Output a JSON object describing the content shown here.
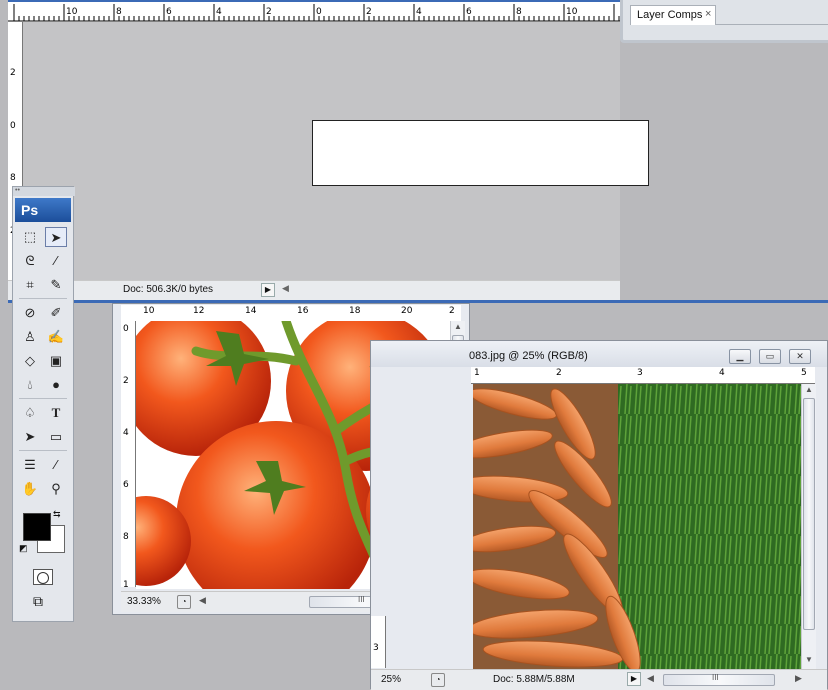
{
  "top_window": {
    "ruler_numbers": [
      "10",
      "8",
      "6",
      "4",
      "2",
      "0",
      "2",
      "4",
      "6",
      "8",
      "10"
    ],
    "vruler_numbers": [
      "2",
      "0",
      "8",
      "2"
    ],
    "status": "Doc: 506.3K/0 bytes"
  },
  "panel": {
    "tab_label": "Layer Comps",
    "close_glyph": "×"
  },
  "toolbox": {
    "logo": "Ps",
    "tools": [
      "marquee-tool",
      "move-tool",
      "lasso-tool",
      "magic-wand-tool",
      "crop-tool",
      "slice-tool",
      "healing-brush-tool",
      "brush-tool",
      "clone-stamp-tool",
      "history-brush-tool",
      "eraser-tool",
      "gradient-tool",
      "blur-tool",
      "dodge-tool",
      "pen-tool",
      "type-tool",
      "path-selection-tool",
      "shape-tool",
      "notes-tool",
      "eyedropper-tool",
      "hand-tool",
      "zoom-tool"
    ],
    "foreground_color": "#000000",
    "background_color": "#ffffff"
  },
  "tomato_window": {
    "ruler_numbers": [
      "10",
      "12",
      "14",
      "16",
      "18",
      "20",
      "2"
    ],
    "vruler_numbers": [
      "0",
      "2",
      "4",
      "6",
      "8",
      "1"
    ],
    "zoom": "33.33%",
    "scroll_mark": "III"
  },
  "carrot_window": {
    "title": "083.jpg @ 25% (RGB/8)",
    "ruler_numbers": [
      "1",
      "2",
      "3",
      "4",
      "5"
    ],
    "vruler_numbers": [
      "3"
    ],
    "zoom": "25%",
    "status": "Doc: 5.88M/5.88M",
    "scroll_mark": "III"
  },
  "colors": {
    "workspace": "#b9b9bc",
    "canvas_gray": "#c4c4c6",
    "accent": "#3b6ab6"
  }
}
